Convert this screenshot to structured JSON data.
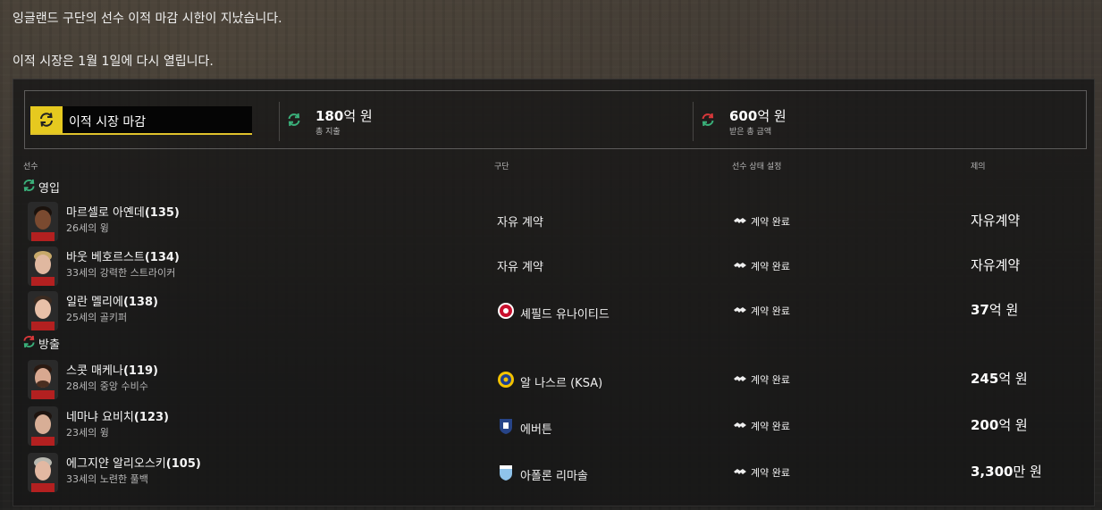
{
  "notice": {
    "line1": "잉글랜드 구단의 선수 이적 마감 시한이 지났습니다.",
    "line2": "이적 시장은 1월 1일에 다시 열립니다."
  },
  "summary": {
    "deadline_label": "이적 시장 마감",
    "spent_amount": "180",
    "spent_unit": "억 원",
    "spent_caption": "총 지출",
    "received_amount": "600",
    "received_unit": "억 원",
    "received_caption": "받은 총 금액"
  },
  "columns": {
    "player": "선수",
    "club": "구단",
    "status": "선수 상태 설정",
    "offer": "제의"
  },
  "sections": {
    "incoming": "영입",
    "outgoing": "방출"
  },
  "colors": {
    "accent_yellow": "#e6c91f",
    "incoming_green": "#3ab07a",
    "outgoing_red": "#d9383a"
  },
  "incoming": [
    {
      "name": "마르셀로 아옌데",
      "rating": "(135)",
      "desc": "26세의 윙",
      "club": "자유 계약",
      "club_icon": "",
      "status": "계약 완료",
      "fee_num": "",
      "fee_rest": "자유계약"
    },
    {
      "name": "바웃 베호르스트",
      "rating": "(134)",
      "desc": "33세의 강력한 스트라이커",
      "club": "자유 계약",
      "club_icon": "",
      "status": "계약 완료",
      "fee_num": "",
      "fee_rest": "자유계약"
    },
    {
      "name": "일란 멜리에",
      "rating": "(138)",
      "desc": "25세의 골키퍼",
      "club": "셰필드 유나이티드",
      "club_icon": "sheffield-united-crest",
      "status": "계약 완료",
      "fee_num": "37",
      "fee_rest": "억 원"
    }
  ],
  "outgoing": [
    {
      "name": "스콧 매케나",
      "rating": "(119)",
      "desc": "28세의 중앙 수비수",
      "club": "알 나스르 (KSA)",
      "club_icon": "al-nassr-crest",
      "status": "계약 완료",
      "fee_num": "245",
      "fee_rest": "억 원"
    },
    {
      "name": "네마냐 요비치",
      "rating": "(123)",
      "desc": "23세의 윙",
      "club": "에버튼",
      "club_icon": "everton-crest",
      "status": "계약 완료",
      "fee_num": "200",
      "fee_rest": "억 원"
    },
    {
      "name": "에그지얀 알리오스키",
      "rating": "(105)",
      "desc": "33세의 노련한 풀백",
      "club": "아폴론 리마솔",
      "club_icon": "apollon-limassol-crest",
      "status": "계약 완료",
      "fee_num": "3,300",
      "fee_rest": "만 원"
    }
  ]
}
